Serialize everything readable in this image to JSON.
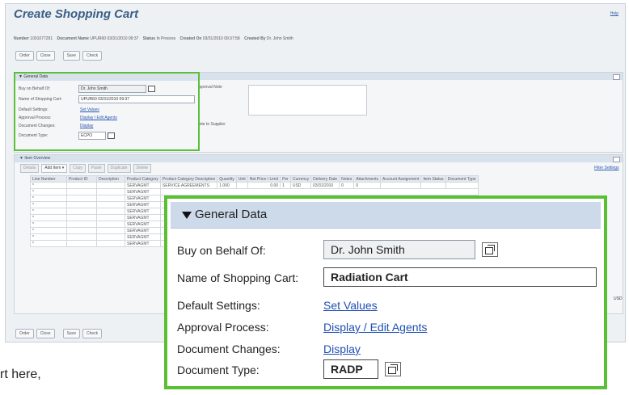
{
  "title": "Create Shopping Cart",
  "help_link": "Help",
  "header": {
    "number_label": "Number",
    "number_value": "1001077291",
    "docname_label": "Document Name",
    "docname_value": "UPUR60 03/31/2010 09:37",
    "status_label": "Status",
    "status_value": "In Process",
    "created_on_label": "Created On",
    "created_on_value": "03/31/2010 09:37:58",
    "created_by_label": "Created By",
    "created_by_value": "Dr. John Smith"
  },
  "top_buttons": [
    "Order",
    "Close",
    "Save",
    "Check"
  ],
  "bottom_buttons": [
    "Order",
    "Close",
    "Save",
    "Check"
  ],
  "general_data_small": {
    "heading": "General Data",
    "buy_on_behalf_label": "Buy on Behalf Of:",
    "buy_on_behalf_value": "Dr. John Smith",
    "cart_name_label": "Name of Shopping Cart:",
    "cart_name_value": "UPUR60 03/31/2010 09:37",
    "default_settings_label": "Default Settings:",
    "default_settings_link": "Set Values",
    "approval_label": "Approval Process:",
    "approval_link": "Display / Edit Agents",
    "doc_changes_label": "Document Changes:",
    "doc_changes_link": "Display",
    "doc_type_label": "Document Type:",
    "doc_type_value": "ECPO"
  },
  "approval_note_label": "Approval Note",
  "note_supplier_label": "Note to Supplier",
  "item_overview": {
    "heading": "Item Overview",
    "filter_link": "Filter Settings",
    "toolbar": [
      "Details",
      "Add Item",
      "Copy",
      "Paste",
      "Duplicate",
      "Delete"
    ],
    "columns": [
      "Line Number",
      "Product ID",
      "Description",
      "Product Category",
      "Product Category Description",
      "Quantity",
      "Unit",
      "Net Price / Limit",
      "Per",
      "Currency",
      "Delivery Date",
      "Notes",
      "Attachments",
      "Account Assignment",
      "Item Status",
      "Document Type"
    ],
    "first_row": [
      "",
      "",
      "",
      "SERVAGMT",
      "SERVICE AGREEMENTS",
      "1.000",
      "",
      "0.00",
      "1",
      "USD",
      "03/31/2010",
      "0",
      "0",
      "",
      "",
      ""
    ],
    "category_rows": [
      "SERVAGMT",
      "SERVAGMT",
      "SERVAGMT",
      "SERVAGMT",
      "SERVAGMT",
      "SERVAGMT",
      "SERVAGMT",
      "SERVAGMT",
      "SERVAGMT"
    ],
    "right_currency": "USD"
  },
  "zoom": {
    "heading": "General Data",
    "buy_on_behalf_label": "Buy on Behalf Of:",
    "buy_on_behalf_value": "Dr. John Smith",
    "cart_name_label": "Name of Shopping Cart:",
    "cart_name_value": "Radiation Cart",
    "default_settings_label": "Default Settings:",
    "default_settings_link": "Set Values",
    "approval_label": "Approval Process:",
    "approval_link": "Display / Edit Agents",
    "doc_changes_label": "Document Changes:",
    "doc_changes_link": "Display",
    "doc_type_label": "Document Type:",
    "doc_type_value": "RADP"
  },
  "cut_text": "rt here,",
  "colors": {
    "highlight_green": "#58c032",
    "title_blue": "#3b5f86",
    "link_blue": "#1f4fb3",
    "panel_header": "#ccdaea"
  }
}
